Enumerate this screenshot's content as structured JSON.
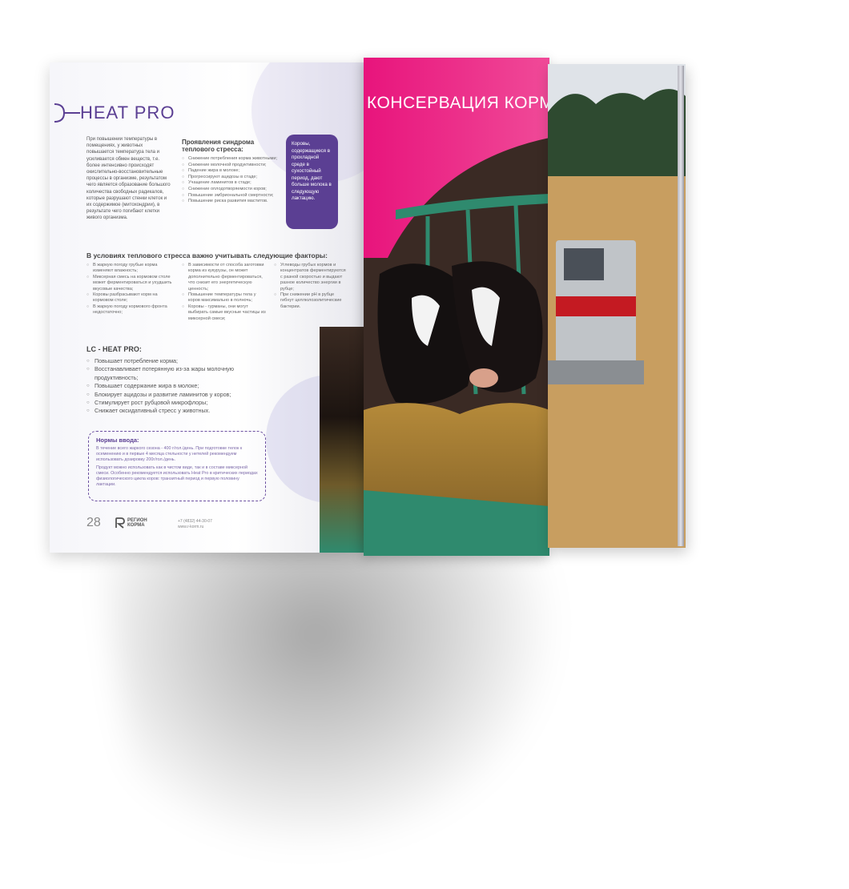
{
  "left": {
    "title": "HEAT PRO",
    "intro": "При повышении температуры в помещениях, у животных повышается температура тела и усиливается обмен веществ, т.е. более интенсивно происходят окислительно-восстановительные процессы в организме, результатом чего является образование большого количества свободных радикалов, которые разрушают стенки клеток и их содержимое (митохондрии), в результате чего погибают клетки живого организма.",
    "symptoms_heading": "Проявления синдрома теплового стресса:",
    "symptoms": [
      "Снижение потребления корма животными;",
      "Снижение молочной продуктивности;",
      "Падение жира в молоке;",
      "Прогрессируют ацидозы в стаде;",
      "Учащение ламинитов в стаде;",
      "Снижение оплодотворяемости коров;",
      "Повышение эмбриональной смертности;",
      "Повышение риска развития маститов."
    ],
    "callout": "Коровы, содержащиеся в прохладной среде в сухостойный период, дают больше молока в следующую лактацию.",
    "factors_heading": "В условиях теплового стресса важно учитывать следующие факторы:",
    "factors_col1": [
      "В жаркую погоду грубые корма изменяют влажность;",
      "Миксерная смесь на кормовом столе может ферментироваться и ухудшить вкусовые качества;",
      "Коровы разбрасывают корм на кормовом столе;",
      "В жаркую погоду кормового фронта недостаточно;"
    ],
    "factors_col2": [
      "В зависимости от способа заготовки корма из кукурузы, он может дополнительно ферментироваться, что снизит его энергетическую ценность;",
      "Повышение температуры тела у коров максимально в полночь;",
      "Коровы - гурманы, они могут выбирать самые вкусные частицы из миксерной смеси;"
    ],
    "factors_col3": [
      "Углеводы грубых кормов и концентратов ферментируются с разной скоростью и выдают разное количество энергии в рубце;",
      "При снижении pH в рубце гибнут целлюлозолитические бактерии."
    ],
    "lc_heading": "LC - HEAT PRO:",
    "benefits": [
      "Повышает потребление корма;",
      "Восстанавливает потерянную из-за жары молочную продуктивность;",
      "Повышает содержание жира в молоке;",
      "Блокирует ацидозы и развитие ламинитов у коров;",
      "Стимулирует рост рубцовой микрофлоры;",
      "Снижает оксидативный стресс у животных."
    ],
    "norms_heading": "Нормы ввода:",
    "norms_p1": "В течение всего жаркого сезона - 400 г/гол./день. При подготовке телок к осеменению и в первые 4 месяца стельности у нетелей рекомендуем использовать дозировку 200г/гол./день.",
    "norms_p2": "Продукт можно использовать как в чистом виде, так и в составе миксерной смеси. Особенно рекомендуется использовать Heat Pro в критических периодах физиологического цикла коров: транзитный период и первую половину лактации.",
    "page_number": "28",
    "brand_line1": "РЕГИОН",
    "brand_line2": "КОРМА",
    "contact_phone": "+7 (4832) 44-30-07",
    "contact_web": "www.r-korm.ru"
  },
  "right": {
    "title": "КОНСЕРВАЦИЯ КОРМА"
  },
  "colors": {
    "accent_purple": "#5b3f93",
    "accent_pink": "#e4157a"
  }
}
